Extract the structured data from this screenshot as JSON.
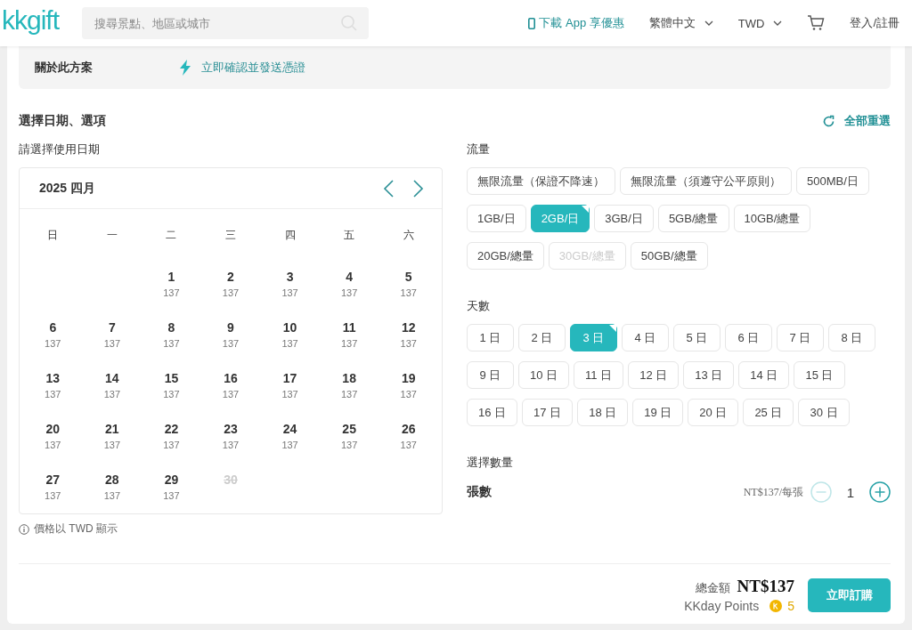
{
  "header": {
    "logo": "kkgift",
    "search_placeholder": "搜尋景點、地區或城市",
    "app_link": "下載 App 享優惠",
    "language": "繁體中文",
    "currency": "TWD",
    "login": "登入/註冊"
  },
  "about": {
    "title": "關於此方案",
    "feature": "立即確認並發送憑證"
  },
  "section": {
    "title": "選擇日期、選項",
    "reset": "全部重選"
  },
  "calendar": {
    "label": "請選擇使用日期",
    "month": "2025 四月",
    "weekdays": [
      "日",
      "一",
      "二",
      "三",
      "四",
      "五",
      "六"
    ],
    "weeks": [
      [
        {
          "day": "1",
          "price": "137",
          "disabled": false
        },
        {
          "day": "2",
          "price": "137",
          "disabled": false
        },
        {
          "day": "3",
          "price": "137",
          "disabled": false
        },
        {
          "day": "4",
          "price": "137",
          "disabled": false
        },
        {
          "day": "5",
          "price": "137",
          "disabled": false
        }
      ],
      [
        {
          "day": "6",
          "price": "137",
          "disabled": false
        },
        {
          "day": "7",
          "price": "137",
          "disabled": false
        },
        {
          "day": "8",
          "price": "137",
          "disabled": false
        },
        {
          "day": "9",
          "price": "137",
          "disabled": false
        },
        {
          "day": "10",
          "price": "137",
          "disabled": false
        },
        {
          "day": "11",
          "price": "137",
          "disabled": false
        },
        {
          "day": "12",
          "price": "137",
          "disabled": false
        }
      ],
      [
        {
          "day": "13",
          "price": "137",
          "disabled": false
        },
        {
          "day": "14",
          "price": "137",
          "disabled": false
        },
        {
          "day": "15",
          "price": "137",
          "disabled": false
        },
        {
          "day": "16",
          "price": "137",
          "disabled": false
        },
        {
          "day": "17",
          "price": "137",
          "disabled": false
        },
        {
          "day": "18",
          "price": "137",
          "disabled": false
        },
        {
          "day": "19",
          "price": "137",
          "disabled": false
        }
      ],
      [
        {
          "day": "20",
          "price": "137",
          "disabled": false
        },
        {
          "day": "21",
          "price": "137",
          "disabled": false
        },
        {
          "day": "22",
          "price": "137",
          "disabled": false
        },
        {
          "day": "23",
          "price": "137",
          "disabled": false
        },
        {
          "day": "24",
          "price": "137",
          "disabled": false
        },
        {
          "day": "25",
          "price": "137",
          "disabled": false
        },
        {
          "day": "26",
          "price": "137",
          "disabled": false
        }
      ],
      [
        {
          "day": "27",
          "price": "137",
          "disabled": false
        },
        {
          "day": "28",
          "price": "137",
          "disabled": false
        },
        {
          "day": "29",
          "price": "137",
          "disabled": false
        },
        {
          "day": "30",
          "disabled": true
        }
      ]
    ],
    "note": "價格以 TWD 顯示"
  },
  "options": [
    {
      "label": "流量",
      "chips": [
        {
          "label": "無限流量（保證不降速）",
          "selected": false,
          "disabled": false
        },
        {
          "label": "無限流量（須遵守公平原則）",
          "selected": false,
          "disabled": false
        },
        {
          "label": "500MB/日",
          "selected": false,
          "disabled": false
        },
        {
          "label": "1GB/日",
          "selected": false,
          "disabled": false
        },
        {
          "label": "2GB/日",
          "selected": true,
          "disabled": false
        },
        {
          "label": "3GB/日",
          "selected": false,
          "disabled": false
        },
        {
          "label": "5GB/總量",
          "selected": false,
          "disabled": false
        },
        {
          "label": "10GB/總量",
          "selected": false,
          "disabled": false
        },
        {
          "label": "20GB/總量",
          "selected": false,
          "disabled": false
        },
        {
          "label": "30GB/總量",
          "selected": false,
          "disabled": true
        },
        {
          "label": "50GB/總量",
          "selected": false,
          "disabled": false
        }
      ]
    },
    {
      "label": "天數",
      "chips": [
        {
          "label": "1 日",
          "selected": false,
          "disabled": false
        },
        {
          "label": "2 日",
          "selected": false,
          "disabled": false
        },
        {
          "label": "3 日",
          "selected": true,
          "disabled": false
        },
        {
          "label": "4 日",
          "selected": false,
          "disabled": false
        },
        {
          "label": "5 日",
          "selected": false,
          "disabled": false
        },
        {
          "label": "6 日",
          "selected": false,
          "disabled": false
        },
        {
          "label": "7 日",
          "selected": false,
          "disabled": false
        },
        {
          "label": "8 日",
          "selected": false,
          "disabled": false
        },
        {
          "label": "9 日",
          "selected": false,
          "disabled": false
        },
        {
          "label": "10 日",
          "selected": false,
          "disabled": false
        },
        {
          "label": "11 日",
          "selected": false,
          "disabled": false
        },
        {
          "label": "12 日",
          "selected": false,
          "disabled": false
        },
        {
          "label": "13 日",
          "selected": false,
          "disabled": false
        },
        {
          "label": "14 日",
          "selected": false,
          "disabled": false
        },
        {
          "label": "15 日",
          "selected": false,
          "disabled": false
        },
        {
          "label": "16 日",
          "selected": false,
          "disabled": false
        },
        {
          "label": "17 日",
          "selected": false,
          "disabled": false
        },
        {
          "label": "18 日",
          "selected": false,
          "disabled": false
        },
        {
          "label": "19 日",
          "selected": false,
          "disabled": false
        },
        {
          "label": "20 日",
          "selected": false,
          "disabled": false
        },
        {
          "label": "25 日",
          "selected": false,
          "disabled": false
        },
        {
          "label": "30 日",
          "selected": false,
          "disabled": false
        }
      ]
    }
  ],
  "quantity": {
    "label": "選擇數量",
    "item": "張數",
    "unit_price": "NT$137/每張",
    "count": "1",
    "minus_disabled": true,
    "plus_disabled": false
  },
  "footer": {
    "total_label": "總金額",
    "total": "NT$137",
    "points_label": "KKday Points",
    "points": "5",
    "book_button": "立即訂購"
  }
}
